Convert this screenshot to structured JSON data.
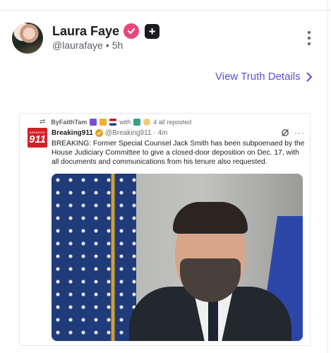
{
  "post": {
    "author_name": "Laura Faye",
    "handle": "@laurafaye",
    "separator": "•",
    "age": "5h",
    "view_details_label": "View Truth Details",
    "icons": [
      "verified-badge-icon",
      "plus-badge-icon",
      "more-options-icon",
      "chevron-right-icon"
    ],
    "colors": {
      "link": "#5a4fd8",
      "verified": "#e6477a"
    }
  },
  "embed": {
    "repost_by": "ByFaithTam",
    "repost_with": "with",
    "repost_suffix": "4 all reposted",
    "source_logo_small": "BREAKING",
    "source_logo_num": "911",
    "source_name": "Breaking911",
    "source_handle": "@Breaking911",
    "source_age": "· 4m",
    "text": "BREAKING: Former Special Counsel Jack Smith has been subpoenaed by the House Judiciary Committee to give a closed-door deposition on Dec. 17, with all documents and communications from his tenure also requested.",
    "more_label": "···",
    "icons": [
      "repost-icon",
      "grok-icon",
      "more-icon",
      "news-photo"
    ]
  }
}
